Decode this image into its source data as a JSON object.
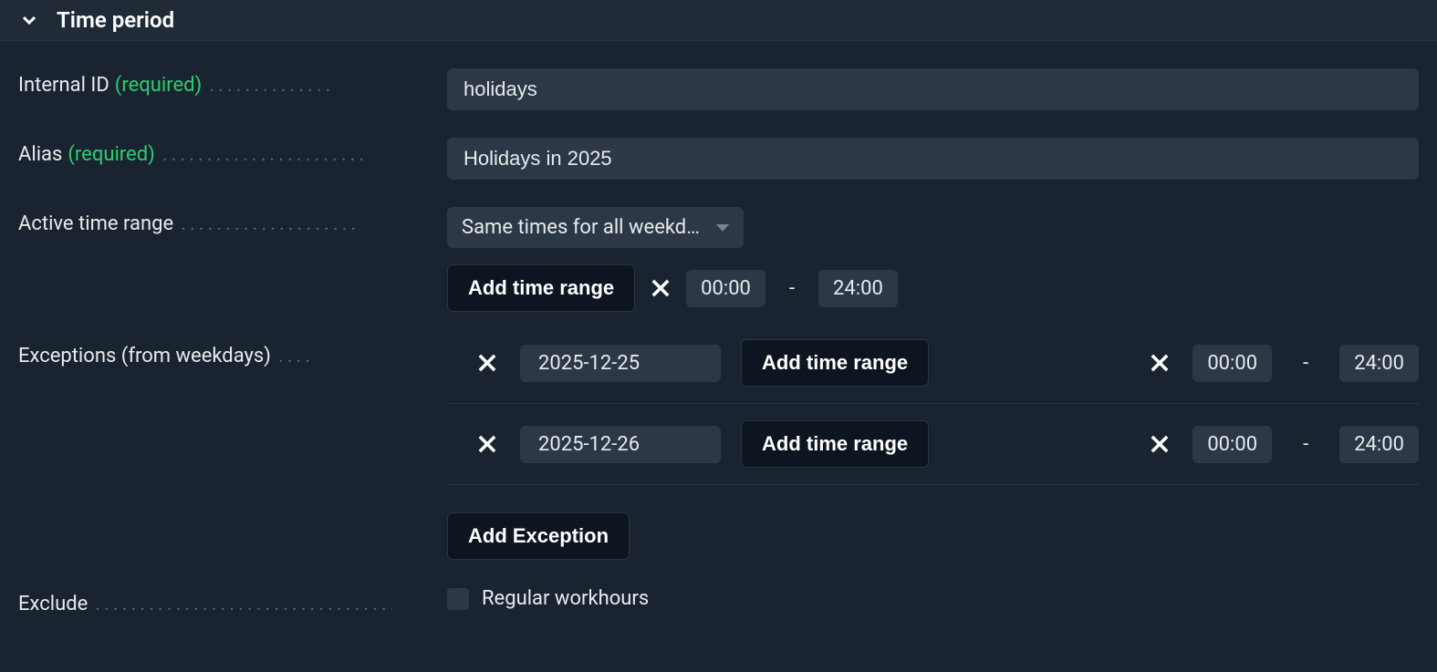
{
  "section": {
    "title": "Time period"
  },
  "fields": {
    "internal_id": {
      "label": "Internal ID",
      "required_tag": "(required)",
      "value": "holidays"
    },
    "alias": {
      "label": "Alias",
      "required_tag": "(required)",
      "value": "Holidays in 2025"
    },
    "active_time_range": {
      "label": "Active time range",
      "select_value": "Same times for all weekd…",
      "add_btn": "Add time range",
      "from": "00:00",
      "to": "24:00"
    },
    "exceptions": {
      "label": "Exceptions (from weekdays)",
      "rows": [
        {
          "date": "2025-12-25",
          "add_btn": "Add time range",
          "from": "00:00",
          "to": "24:00"
        },
        {
          "date": "2025-12-26",
          "add_btn": "Add time range",
          "from": "00:00",
          "to": "24:00"
        }
      ],
      "add_exception_btn": "Add Exception"
    },
    "exclude": {
      "label": "Exclude",
      "checkbox_label": "Regular workhours",
      "checked": false
    }
  }
}
